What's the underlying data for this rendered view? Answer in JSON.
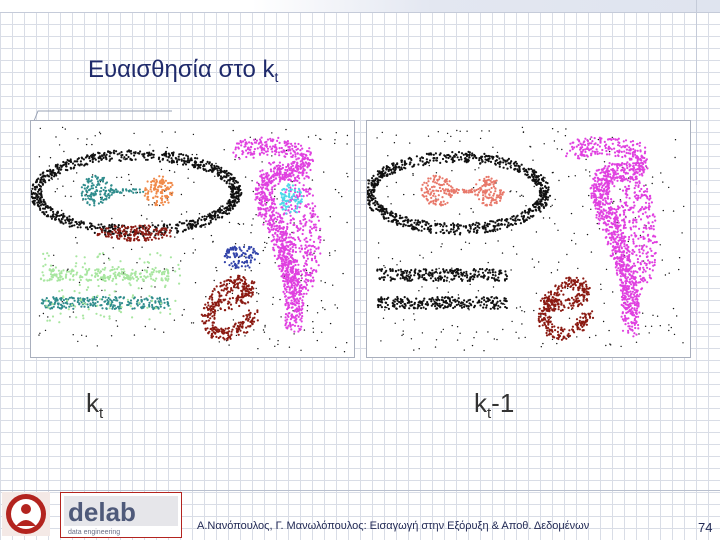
{
  "slide": {
    "title": "Ευαισθησία στο k",
    "title_subscript": "t",
    "left_caption": "k",
    "left_caption_subscript": "t",
    "right_caption": "k",
    "right_caption_subscript": "t",
    "right_caption_suffix": "-1",
    "footer": "Α.Νανόπουλος, Γ. Μανωλόπουλος: Εισαγωγή στην Εξόρυξη & Αποθ. Δεδομένων",
    "page_number": "74"
  },
  "logos": {
    "lab_logo": "delab",
    "lab_logo_text": "data engineering"
  },
  "colors": {
    "title_text": "#1f2a6b",
    "cluster_black": "#111111",
    "cluster_magenta": "#e040e0",
    "cluster_dark_red": "#8b1a12",
    "cluster_teal": "#2f8c8c",
    "cluster_light_green": "#a8e6a0",
    "cluster_orange": "#f08a4a",
    "cluster_cyan": "#4fd8e8",
    "cluster_blue": "#3344aa",
    "cluster_salmon": "#e8786a"
  }
}
